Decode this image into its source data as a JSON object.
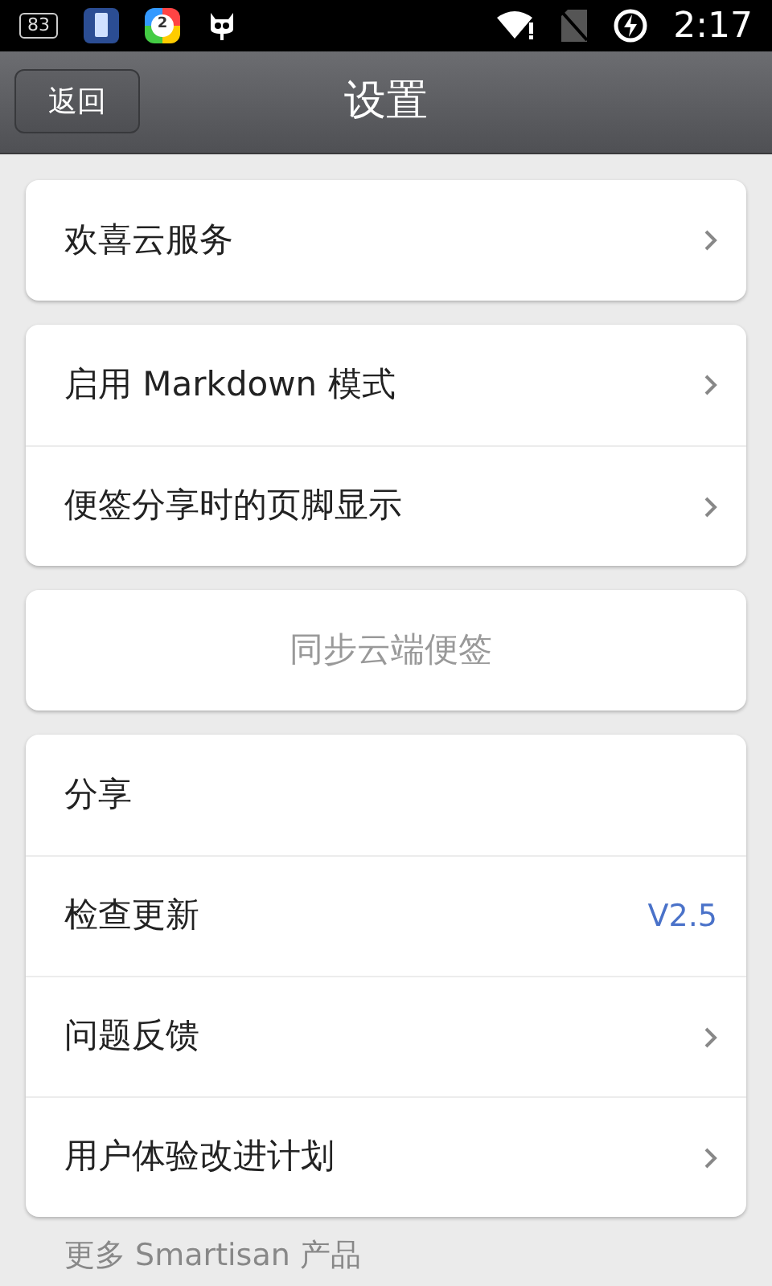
{
  "status_bar": {
    "battery_badge": "83",
    "app_badge": "2",
    "time": "2:17"
  },
  "nav_bar": {
    "back_button": "返回",
    "title": "设置"
  },
  "groups": [
    {
      "rows": [
        {
          "kind": "link",
          "label": "欢喜云服务"
        }
      ]
    },
    {
      "rows": [
        {
          "kind": "link",
          "label": "启用 Markdown 模式"
        },
        {
          "kind": "link",
          "label": "便签分享时的页脚显示"
        }
      ]
    },
    {
      "rows": [
        {
          "kind": "action",
          "label": "同步云端便签"
        }
      ]
    },
    {
      "rows": [
        {
          "kind": "plain",
          "label": "分享"
        },
        {
          "kind": "value",
          "label": "检查更新",
          "value": "V2.5"
        },
        {
          "kind": "link",
          "label": "问题反馈"
        },
        {
          "kind": "link",
          "label": "用户体验改进计划"
        }
      ]
    }
  ],
  "footer": "更多 Smartisan 产品"
}
